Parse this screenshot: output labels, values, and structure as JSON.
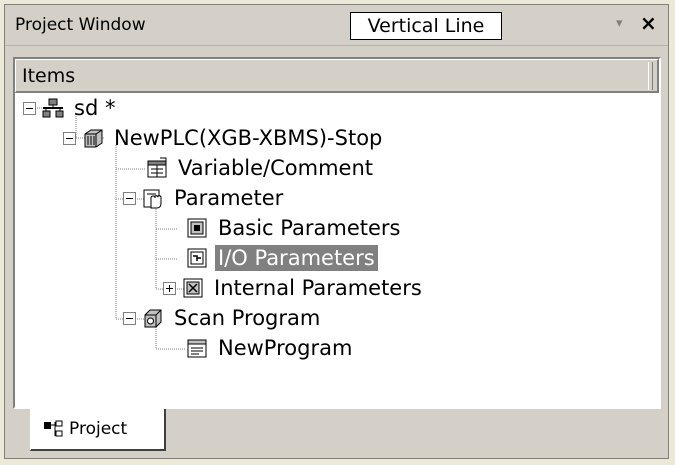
{
  "window": {
    "title": "Project Window",
    "tooltip": "Vertical Line",
    "dropdown_glyph": "▾",
    "close_glyph": "×"
  },
  "tree_header": {
    "label": "Items"
  },
  "tree": {
    "nodes": [
      {
        "label": "sd *",
        "icon": "network-icon",
        "expander": "minus"
      },
      {
        "label": "NewPLC(XGB-XBMS)-Stop",
        "icon": "plc-icon",
        "expander": "minus"
      },
      {
        "label": "Variable/Comment",
        "icon": "variable-comment-icon",
        "expander": "none"
      },
      {
        "label": "Parameter",
        "icon": "parameter-icon",
        "expander": "minus"
      },
      {
        "label": "Basic Parameters",
        "icon": "basic-parameters-icon",
        "expander": "none"
      },
      {
        "label": "I/O Parameters",
        "icon": "io-parameters-icon",
        "expander": "none",
        "selected": true
      },
      {
        "label": "Internal Parameters",
        "icon": "internal-parameters-icon",
        "expander": "plus"
      },
      {
        "label": "Scan Program",
        "icon": "scan-program-icon",
        "expander": "minus"
      },
      {
        "label": "NewProgram",
        "icon": "program-icon",
        "expander": "none"
      }
    ]
  },
  "tabs": [
    {
      "label": "Project",
      "icon": "project-tree-icon",
      "active": true
    }
  ]
}
